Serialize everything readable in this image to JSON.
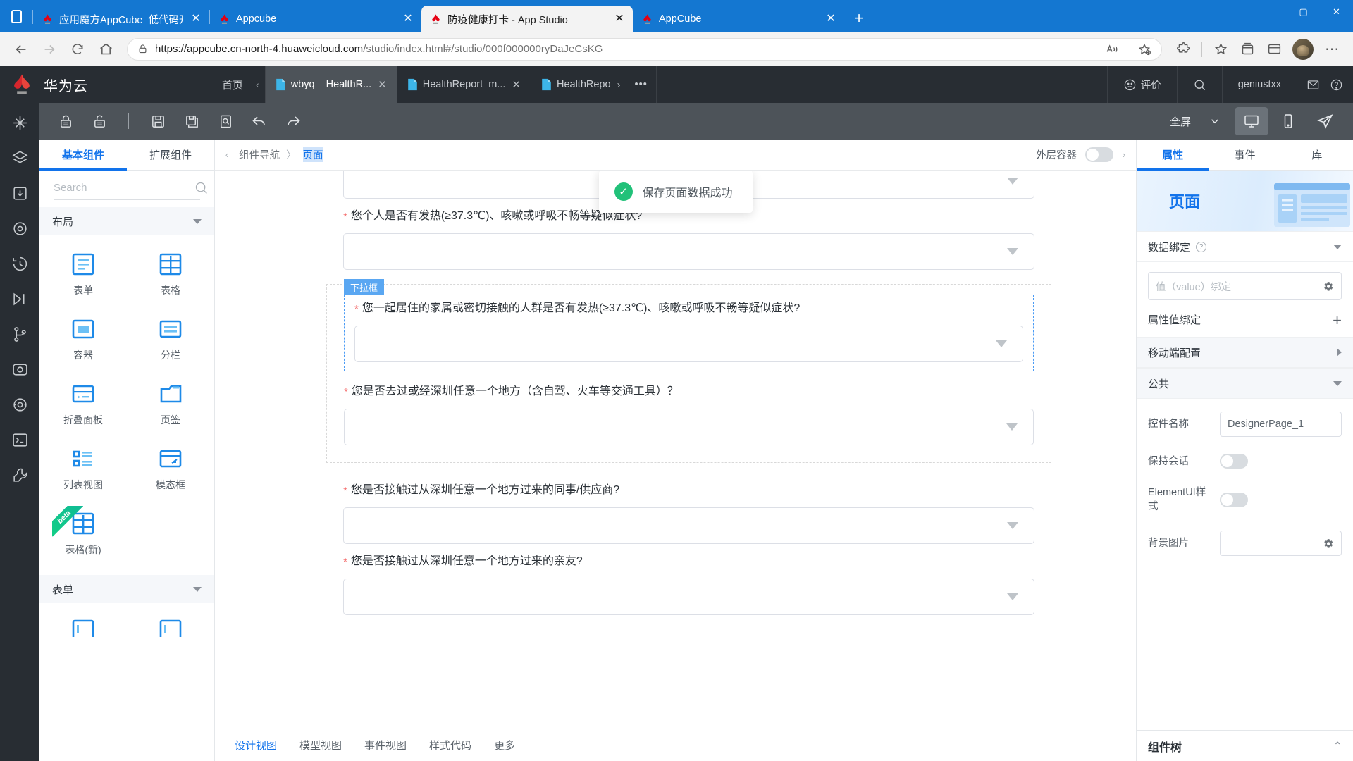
{
  "browser": {
    "tabs": [
      {
        "title": "应用魔方AppCube_低代码开发平",
        "close": "✕",
        "active": false
      },
      {
        "title": "Appcube",
        "close": "✕",
        "active": false
      },
      {
        "title": "防疫健康打卡 - App Studio",
        "close": "✕",
        "active": true
      },
      {
        "title": "AppCube",
        "close": "✕",
        "active": false
      }
    ],
    "new_tab_label": "+",
    "window_controls": {
      "minimize": "—",
      "maximize": "▢",
      "close": "✕"
    },
    "toolbar": {
      "back": "←",
      "forward": "→",
      "reload": "⟳",
      "home": "⌂",
      "url_host": "https://appcube.cn-north-4.huaweicloud.com",
      "url_path": "/studio/index.html#/studio/000f000000ryDaJeCsKG",
      "read_aloud": "A",
      "favorite": "☆",
      "collections": "⊞",
      "extensions": "🧩",
      "favorites_bar": "☆",
      "settings": "⋯"
    }
  },
  "app_header": {
    "brand": "华为云",
    "home": "首页",
    "scroll_left": "‹",
    "doc_tabs": [
      {
        "label": "wbyq__HealthR...",
        "close": "✕",
        "active": true
      },
      {
        "label": "HealthReport_m...",
        "close": "✕",
        "active": false
      },
      {
        "label": "HealthRepo",
        "close": "›",
        "active": false
      }
    ],
    "tabs_overflow": "•••",
    "feedback": "评价",
    "search_icon": "search-icon",
    "user": "geniustxx",
    "mail_icon": "mail-icon",
    "help_icon": "help-icon"
  },
  "toolbar": {
    "lock": "lock-icon",
    "unlock": "unlock-icon",
    "save": "save-icon",
    "save_as": "save-as-icon",
    "preview": "preview-icon",
    "undo": "undo-icon",
    "redo": "redo-icon",
    "fullscreen_label": "全屏",
    "dropdown": "chevron-down-icon",
    "desktop_view": "desktop-icon",
    "mobile_view": "mobile-icon",
    "publish": "publish-icon"
  },
  "component_panel": {
    "tabs": [
      {
        "label": "基本组件",
        "active": true
      },
      {
        "label": "扩展组件",
        "active": false
      }
    ],
    "search_placeholder": "Search",
    "search_value": "",
    "groups": [
      {
        "title": "布局",
        "items": [
          {
            "label": "表单",
            "icon": "form-icon"
          },
          {
            "label": "表格",
            "icon": "table-icon"
          },
          {
            "label": "容器",
            "icon": "container-icon"
          },
          {
            "label": "分栏",
            "icon": "columns-icon"
          },
          {
            "label": "折叠面板",
            "icon": "collapse-panel-icon"
          },
          {
            "label": "页签",
            "icon": "tab-page-icon"
          },
          {
            "label": "列表视图",
            "icon": "list-view-icon"
          },
          {
            "label": "模态框",
            "icon": "modal-icon"
          },
          {
            "label": "表格(新)",
            "icon": "table-new-icon",
            "badge": "beta"
          }
        ]
      },
      {
        "title": "表单",
        "items": []
      }
    ]
  },
  "canvas": {
    "breadcrumb": {
      "root": "组件导航",
      "sep": "〉",
      "current": "页面"
    },
    "outer_container_label": "外层容器",
    "outer_container_on": false,
    "toast": {
      "message": "保存页面数据成功",
      "icon": "check-icon"
    },
    "selected_component_tag": "下拉框",
    "questions": [
      {
        "label": "",
        "required": false,
        "partial": true
      },
      {
        "label": "您个人是否有发热(≥37.3℃)、咳嗽或呼吸不畅等疑似症状?",
        "required": true,
        "selected": false
      },
      {
        "label": "您一起居住的家属或密切接触的人群是否有发热(≥37.3℃)、咳嗽或呼吸不畅等疑似症状?",
        "required": true,
        "selected": true
      },
      {
        "label": "您是否去过或经深圳任意一个地方（含自驾、火车等交通工具）？",
        "required": true,
        "selected": false
      },
      {
        "label": "您是否接触过从深圳任意一个地方过来的同事/供应商?",
        "required": true,
        "selected": false
      },
      {
        "label": "您是否接触过从深圳任意一个地方过来的亲友?",
        "required": true,
        "selected": false
      }
    ],
    "bottom_tabs": [
      {
        "label": "设计视图",
        "active": true
      },
      {
        "label": "模型视图",
        "active": false
      },
      {
        "label": "事件视图",
        "active": false
      },
      {
        "label": "样式代码",
        "active": false
      },
      {
        "label": "更多",
        "active": false
      }
    ]
  },
  "props_panel": {
    "tabs": [
      {
        "label": "属性",
        "active": true
      },
      {
        "label": "事件",
        "active": false
      },
      {
        "label": "库",
        "active": false
      }
    ],
    "hero_title": "页面",
    "sections": {
      "data_binding": {
        "title": "数据绑定",
        "help": "?",
        "value_placeholder": "值（value）绑定",
        "value": "",
        "attr_binding_label": "属性值绑定",
        "add": "+"
      },
      "mobile_config": {
        "title": "移动端配置"
      },
      "common": {
        "title": "公共",
        "control_name_label": "控件名称",
        "control_name_value": "DesignerPage_1",
        "keep_session_label": "保持会话",
        "keep_session_on": false,
        "element_ui_label": "ElementUI样式",
        "element_ui_on": false,
        "background_image_label": "背景图片",
        "background_image_value": ""
      }
    },
    "component_tree": {
      "title": "组件树",
      "collapse": "⌃"
    }
  },
  "colors": {
    "accent": "#1273eb",
    "header_bg": "#282d33",
    "toolbar_bg": "#4d5359",
    "browser_blue": "#1477d1",
    "required_red": "#f56c6c",
    "success_green": "#21c179"
  }
}
